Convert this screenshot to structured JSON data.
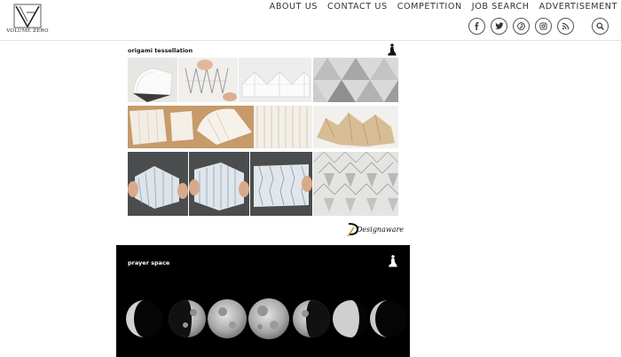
{
  "site": {
    "logo_text": "VOLUME ZERO",
    "logo_mark": "V"
  },
  "nav": {
    "items": [
      "ABOUT US",
      "CONTACT US",
      "COMPETITION",
      "JOB SEARCH",
      "ADVERTISEMENT"
    ]
  },
  "social": {
    "icons": [
      "facebook-icon",
      "twitter-icon",
      "pinterest-icon",
      "instagram-icon",
      "rss-icon"
    ],
    "search_icon": "search-icon"
  },
  "cards": [
    {
      "title": "origami tessellation",
      "brand": "Designaware"
    },
    {
      "title": "prayer space"
    }
  ],
  "colors": {
    "nav_text": "#333333",
    "border": "#e4e4e4",
    "card2_bg": "#000000",
    "brand_accent": "#c59220"
  }
}
